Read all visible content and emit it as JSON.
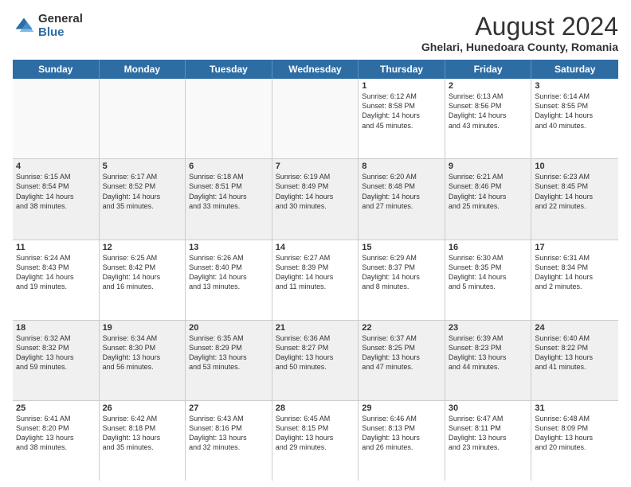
{
  "logo": {
    "general": "General",
    "blue": "Blue"
  },
  "title": "August 2024",
  "subtitle": "Ghelari, Hunedoara County, Romania",
  "days": [
    "Sunday",
    "Monday",
    "Tuesday",
    "Wednesday",
    "Thursday",
    "Friday",
    "Saturday"
  ],
  "rows": [
    [
      {
        "day": "",
        "text": "",
        "empty": true
      },
      {
        "day": "",
        "text": "",
        "empty": true
      },
      {
        "day": "",
        "text": "",
        "empty": true
      },
      {
        "day": "",
        "text": "",
        "empty": true
      },
      {
        "day": "1",
        "text": "Sunrise: 6:12 AM\nSunset: 8:58 PM\nDaylight: 14 hours\nand 45 minutes.",
        "empty": false
      },
      {
        "day": "2",
        "text": "Sunrise: 6:13 AM\nSunset: 8:56 PM\nDaylight: 14 hours\nand 43 minutes.",
        "empty": false
      },
      {
        "day": "3",
        "text": "Sunrise: 6:14 AM\nSunset: 8:55 PM\nDaylight: 14 hours\nand 40 minutes.",
        "empty": false
      }
    ],
    [
      {
        "day": "4",
        "text": "Sunrise: 6:15 AM\nSunset: 8:54 PM\nDaylight: 14 hours\nand 38 minutes.",
        "empty": false
      },
      {
        "day": "5",
        "text": "Sunrise: 6:17 AM\nSunset: 8:52 PM\nDaylight: 14 hours\nand 35 minutes.",
        "empty": false
      },
      {
        "day": "6",
        "text": "Sunrise: 6:18 AM\nSunset: 8:51 PM\nDaylight: 14 hours\nand 33 minutes.",
        "empty": false
      },
      {
        "day": "7",
        "text": "Sunrise: 6:19 AM\nSunset: 8:49 PM\nDaylight: 14 hours\nand 30 minutes.",
        "empty": false
      },
      {
        "day": "8",
        "text": "Sunrise: 6:20 AM\nSunset: 8:48 PM\nDaylight: 14 hours\nand 27 minutes.",
        "empty": false
      },
      {
        "day": "9",
        "text": "Sunrise: 6:21 AM\nSunset: 8:46 PM\nDaylight: 14 hours\nand 25 minutes.",
        "empty": false
      },
      {
        "day": "10",
        "text": "Sunrise: 6:23 AM\nSunset: 8:45 PM\nDaylight: 14 hours\nand 22 minutes.",
        "empty": false
      }
    ],
    [
      {
        "day": "11",
        "text": "Sunrise: 6:24 AM\nSunset: 8:43 PM\nDaylight: 14 hours\nand 19 minutes.",
        "empty": false
      },
      {
        "day": "12",
        "text": "Sunrise: 6:25 AM\nSunset: 8:42 PM\nDaylight: 14 hours\nand 16 minutes.",
        "empty": false
      },
      {
        "day": "13",
        "text": "Sunrise: 6:26 AM\nSunset: 8:40 PM\nDaylight: 14 hours\nand 13 minutes.",
        "empty": false
      },
      {
        "day": "14",
        "text": "Sunrise: 6:27 AM\nSunset: 8:39 PM\nDaylight: 14 hours\nand 11 minutes.",
        "empty": false
      },
      {
        "day": "15",
        "text": "Sunrise: 6:29 AM\nSunset: 8:37 PM\nDaylight: 14 hours\nand 8 minutes.",
        "empty": false
      },
      {
        "day": "16",
        "text": "Sunrise: 6:30 AM\nSunset: 8:35 PM\nDaylight: 14 hours\nand 5 minutes.",
        "empty": false
      },
      {
        "day": "17",
        "text": "Sunrise: 6:31 AM\nSunset: 8:34 PM\nDaylight: 14 hours\nand 2 minutes.",
        "empty": false
      }
    ],
    [
      {
        "day": "18",
        "text": "Sunrise: 6:32 AM\nSunset: 8:32 PM\nDaylight: 13 hours\nand 59 minutes.",
        "empty": false
      },
      {
        "day": "19",
        "text": "Sunrise: 6:34 AM\nSunset: 8:30 PM\nDaylight: 13 hours\nand 56 minutes.",
        "empty": false
      },
      {
        "day": "20",
        "text": "Sunrise: 6:35 AM\nSunset: 8:29 PM\nDaylight: 13 hours\nand 53 minutes.",
        "empty": false
      },
      {
        "day": "21",
        "text": "Sunrise: 6:36 AM\nSunset: 8:27 PM\nDaylight: 13 hours\nand 50 minutes.",
        "empty": false
      },
      {
        "day": "22",
        "text": "Sunrise: 6:37 AM\nSunset: 8:25 PM\nDaylight: 13 hours\nand 47 minutes.",
        "empty": false
      },
      {
        "day": "23",
        "text": "Sunrise: 6:39 AM\nSunset: 8:23 PM\nDaylight: 13 hours\nand 44 minutes.",
        "empty": false
      },
      {
        "day": "24",
        "text": "Sunrise: 6:40 AM\nSunset: 8:22 PM\nDaylight: 13 hours\nand 41 minutes.",
        "empty": false
      }
    ],
    [
      {
        "day": "25",
        "text": "Sunrise: 6:41 AM\nSunset: 8:20 PM\nDaylight: 13 hours\nand 38 minutes.",
        "empty": false
      },
      {
        "day": "26",
        "text": "Sunrise: 6:42 AM\nSunset: 8:18 PM\nDaylight: 13 hours\nand 35 minutes.",
        "empty": false
      },
      {
        "day": "27",
        "text": "Sunrise: 6:43 AM\nSunset: 8:16 PM\nDaylight: 13 hours\nand 32 minutes.",
        "empty": false
      },
      {
        "day": "28",
        "text": "Sunrise: 6:45 AM\nSunset: 8:15 PM\nDaylight: 13 hours\nand 29 minutes.",
        "empty": false
      },
      {
        "day": "29",
        "text": "Sunrise: 6:46 AM\nSunset: 8:13 PM\nDaylight: 13 hours\nand 26 minutes.",
        "empty": false
      },
      {
        "day": "30",
        "text": "Sunrise: 6:47 AM\nSunset: 8:11 PM\nDaylight: 13 hours\nand 23 minutes.",
        "empty": false
      },
      {
        "day": "31",
        "text": "Sunrise: 6:48 AM\nSunset: 8:09 PM\nDaylight: 13 hours\nand 20 minutes.",
        "empty": false
      }
    ]
  ]
}
